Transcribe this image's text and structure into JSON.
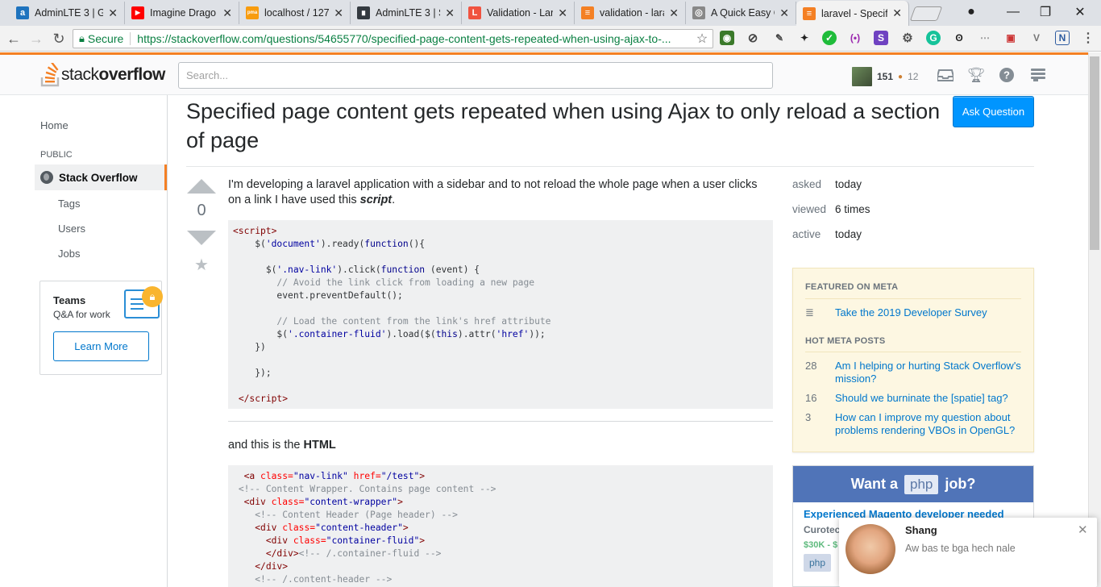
{
  "browser": {
    "tabs": [
      {
        "title": "AdminLTE 3 | G",
        "icon": "adminlte-icon",
        "color": "#1e73be",
        "glyph": "a"
      },
      {
        "title": "Imagine Drago",
        "icon": "youtube-icon",
        "color": "#ff0000",
        "glyph": "▶"
      },
      {
        "title": "localhost / 127",
        "icon": "phpmyadmin-icon",
        "color": "#f89c0e",
        "glyph": "pma"
      },
      {
        "title": "AdminLTE 3 | St",
        "icon": "adminlte-dark-icon",
        "color": "#343a40",
        "glyph": "∎"
      },
      {
        "title": "Validation - Lar",
        "icon": "laravel-icon",
        "color": "#f05340",
        "glyph": "L"
      },
      {
        "title": "validation - lara",
        "icon": "stackoverflow-icon",
        "color": "#f48024",
        "glyph": "≡"
      },
      {
        "title": "A Quick Easy G",
        "icon": "github-icon",
        "color": "#888888",
        "glyph": "◎"
      },
      {
        "title": "laravel - Specif",
        "icon": "stackoverflow-icon",
        "color": "#f48024",
        "glyph": "≡"
      }
    ],
    "secure_label": "Secure",
    "url": "https://stackoverflow.com/questions/54655770/specified-page-content-gets-repeated-when-using-ajax-to-..."
  },
  "header": {
    "logo_text_light": "stack",
    "logo_text_bold": "overflow",
    "search_placeholder": "Search...",
    "reputation": "151",
    "bronze_count": "12"
  },
  "leftnav": {
    "home": "Home",
    "section": "PUBLIC",
    "active": "Stack Overflow",
    "tags": "Tags",
    "users": "Users",
    "jobs": "Jobs",
    "teams_title": "Teams",
    "teams_sub": "Q&A for work",
    "learn_more": "Learn More"
  },
  "question": {
    "title": "Specified page content gets repeated when using Ajax to only reload a section of page",
    "ask_button": "Ask Question",
    "votes": "0",
    "body_text": "I'm developing a laravel application with a sidebar and to not reload the whole page when a user clicks on a link I have used this ",
    "body_emphasis": "script",
    "body_end": ".",
    "para2_text": "and this is the ",
    "para2_bold": "HTML"
  },
  "stats": {
    "asked_label": "asked",
    "asked_value": "today",
    "viewed_label": "viewed",
    "viewed_value": "6 times",
    "active_label": "active",
    "active_value": "today"
  },
  "meta": {
    "featured_header": "FEATURED ON META",
    "featured_item": "Take the 2019 Developer Survey",
    "hot_header": "HOT META POSTS",
    "hot_posts": [
      {
        "count": "28",
        "title": "Am I helping or hurting Stack Overflow's mission?"
      },
      {
        "count": "16",
        "title": "Should we burninate the [spatie] tag?"
      },
      {
        "count": "3",
        "title": "How can I improve my question about problems rendering VBOs in OpenGL?"
      }
    ]
  },
  "jobs": {
    "want": "Want a",
    "lang": "php",
    "job": "job?",
    "title": "Experienced Magento developer needed",
    "company": "Curotec",
    "salary": "$30K - $",
    "tag": "php"
  },
  "notification": {
    "name": "Shang",
    "message": "Aw bas te bga hech nale"
  },
  "colors": {
    "accent": "#f48024",
    "link": "#0077cc",
    "primary_button": "#0095ff"
  }
}
